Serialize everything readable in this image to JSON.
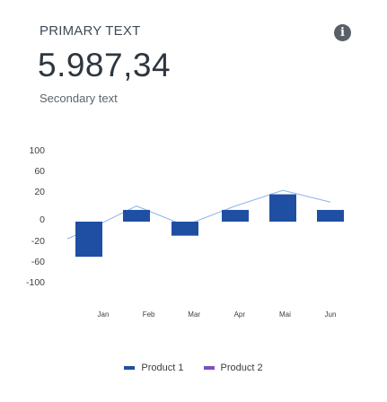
{
  "card": {
    "primary_text": "PRIMARY TEXT",
    "value": "5.987,34",
    "secondary_text": "Secondary text",
    "info_icon": "info-icon"
  },
  "colors": {
    "bar": "#1e4fa3",
    "line": "#8fb2ec",
    "product1": "#1e4fa3",
    "product2": "#7b4fc4",
    "axis_text": "#3a3f46",
    "grid": "#e8e8e8"
  },
  "chart_data": {
    "type": "bar",
    "title": "",
    "categories": [
      "Jan",
      "Feb",
      "Mar",
      "Apr",
      "Mai",
      "Jun"
    ],
    "y_ticks": [
      "100",
      "60",
      "20",
      "0",
      "-20",
      "-60",
      "-100"
    ],
    "series": [
      {
        "name": "Product 1",
        "type": "bar",
        "values": [
          -45,
          15,
          -18,
          15,
          35,
          15
        ]
      },
      {
        "name": "Product 2",
        "type": "line",
        "values": [
          -10,
          20,
          -5,
          20,
          40,
          25
        ]
      }
    ],
    "xlabel": "",
    "ylabel": "",
    "ylim": [
      -100,
      100
    ],
    "legend": [
      "Product 1",
      "Product 2"
    ],
    "legend_position": "bottom",
    "grid": false
  }
}
